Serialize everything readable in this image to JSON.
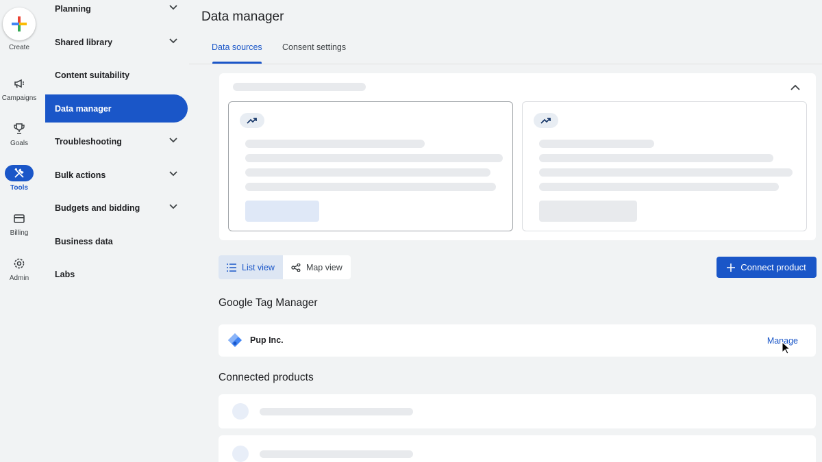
{
  "rail": {
    "create_label": "Create",
    "items": [
      {
        "label": "Campaigns",
        "icon": "megaphone-icon"
      },
      {
        "label": "Goals",
        "icon": "trophy-icon"
      },
      {
        "label": "Tools",
        "icon": "tools-icon",
        "active": true
      },
      {
        "label": "Billing",
        "icon": "card-icon"
      },
      {
        "label": "Admin",
        "icon": "gear-icon"
      }
    ]
  },
  "nav": {
    "items": [
      {
        "label": "Planning",
        "expandable": true
      },
      {
        "label": "Shared library",
        "expandable": true
      },
      {
        "label": "Content suitability",
        "expandable": false
      },
      {
        "label": "Data manager",
        "expandable": false,
        "active": true
      },
      {
        "label": "Troubleshooting",
        "expandable": true
      },
      {
        "label": "Bulk actions",
        "expandable": true
      },
      {
        "label": "Budgets and bidding",
        "expandable": true
      },
      {
        "label": "Business data",
        "expandable": false
      },
      {
        "label": "Labs",
        "expandable": false
      }
    ]
  },
  "page": {
    "title": "Data manager",
    "tabs": [
      {
        "label": "Data sources",
        "active": true
      },
      {
        "label": "Consent settings",
        "active": false
      }
    ]
  },
  "view_toggle": {
    "list_label": "List view",
    "map_label": "Map view",
    "selected": "list"
  },
  "connect_button": {
    "label": "Connect product"
  },
  "gtm_section": {
    "title": "Google Tag Manager",
    "account_name": "Pup Inc.",
    "manage_label": "Manage"
  },
  "connected_section": {
    "title": "Connected products"
  },
  "colors": {
    "accent": "#1a56c8",
    "background": "#f1f3f4",
    "skeleton": "#e8eaed"
  }
}
